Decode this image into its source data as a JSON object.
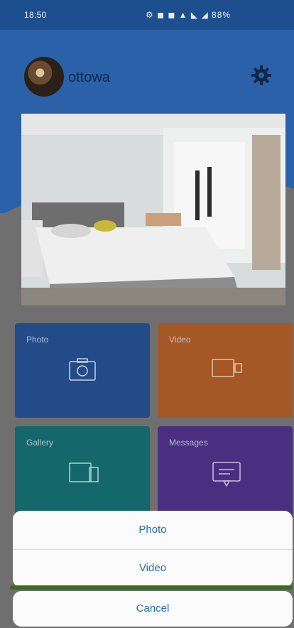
{
  "status_bar": {
    "time": "18:50",
    "icons": "⚙ ◼ ◼ ▲ ◣ ◢ 88%"
  },
  "profile": {
    "username": "ottowa"
  },
  "tiles": [
    {
      "label": "Photo",
      "icon": "camera-icon"
    },
    {
      "label": "Video",
      "icon": "video-icon"
    },
    {
      "label": "Gallery",
      "icon": "gallery-icon"
    },
    {
      "label": "Messages",
      "icon": "message-icon"
    }
  ],
  "action_sheet": {
    "options": [
      "Photo",
      "Video"
    ],
    "cancel": "Cancel"
  },
  "colors": {
    "header": "#2a61a8",
    "tile_photo": "#234b87",
    "tile_video": "#a35826",
    "tile_gallery": "#14676a",
    "tile_messages": "#4a2f80",
    "sheet_text": "#1f6fb5"
  }
}
